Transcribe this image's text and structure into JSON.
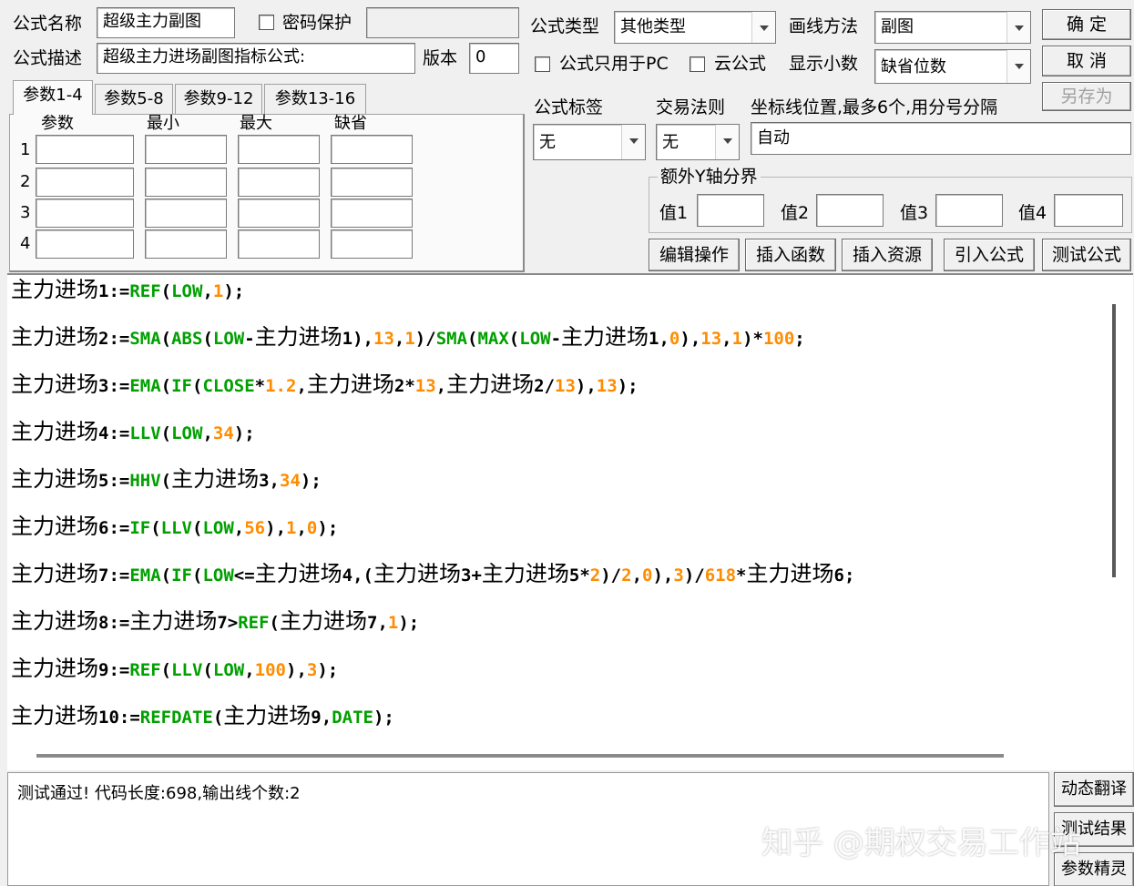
{
  "form": {
    "name_label": "公式名称",
    "name_value": "超级主力副图",
    "password_label": "密码保护",
    "password_value": "",
    "desc_label": "公式描述",
    "desc_value": "超级主力进场副图指标公式:",
    "version_label": "版本",
    "version_value": "0",
    "type_label": "公式类型",
    "type_value": "其他类型",
    "draw_label": "画线方法",
    "draw_value": "副图",
    "pc_only_label": "公式只用于PC",
    "cloud_label": "云公式",
    "decimals_label": "显示小数",
    "decimals_value": "缺省位数",
    "tag_label": "公式标签",
    "tag_value": "无",
    "rule_label": "交易法则",
    "rule_value": "无",
    "axis_label": "坐标线位置,最多6个,用分号分隔",
    "axis_value": "自动",
    "yaxis_group_label": "额外Y轴分界",
    "yaxis_values": [
      "值1",
      "值2",
      "值3",
      "值4"
    ]
  },
  "buttons": {
    "ok": "确 定",
    "cancel": "取 消",
    "save_as": "另存为",
    "edit_ops": "编辑操作",
    "insert_func": "插入函数",
    "insert_res": "插入资源",
    "import_formula": "引入公式",
    "test_formula": "测试公式",
    "dynamic_translate": "动态翻译",
    "test_result": "测试结果",
    "param_wizard": "参数精灵"
  },
  "tabs": [
    "参数1-4",
    "参数5-8",
    "参数9-12",
    "参数13-16"
  ],
  "params": {
    "headers": [
      "参数",
      "最小",
      "最大",
      "缺省"
    ],
    "rows": [
      "1",
      "2",
      "3",
      "4"
    ]
  },
  "code_lines": [
    [
      [
        "cn",
        "主力进场"
      ],
      [
        "p",
        "1:="
      ],
      [
        "k",
        "REF"
      ],
      [
        "p",
        "("
      ],
      [
        "k",
        "LOW"
      ],
      [
        "p",
        ","
      ],
      [
        "n",
        "1"
      ],
      [
        "p",
        ");"
      ]
    ],
    [
      [
        "cn",
        "主力进场"
      ],
      [
        "p",
        "2:="
      ],
      [
        "k",
        "SMA"
      ],
      [
        "p",
        "("
      ],
      [
        "k",
        "ABS"
      ],
      [
        "p",
        "("
      ],
      [
        "k",
        "LOW"
      ],
      [
        "p",
        "-"
      ],
      [
        "cn",
        "主力进场"
      ],
      [
        "p",
        "1),"
      ],
      [
        "n",
        "13"
      ],
      [
        "p",
        ","
      ],
      [
        "n",
        "1"
      ],
      [
        "p",
        ")/"
      ],
      [
        "k",
        "SMA"
      ],
      [
        "p",
        "("
      ],
      [
        "k",
        "MAX"
      ],
      [
        "p",
        "("
      ],
      [
        "k",
        "LOW"
      ],
      [
        "p",
        "-"
      ],
      [
        "cn",
        "主力进场"
      ],
      [
        "p",
        "1,"
      ],
      [
        "n",
        "0"
      ],
      [
        "p",
        "),"
      ],
      [
        "n",
        "13"
      ],
      [
        "p",
        ","
      ],
      [
        "n",
        "1"
      ],
      [
        "p",
        ")*"
      ],
      [
        "n",
        "100"
      ],
      [
        "p",
        ";"
      ]
    ],
    [
      [
        "cn",
        "主力进场"
      ],
      [
        "p",
        "3:="
      ],
      [
        "k",
        "EMA"
      ],
      [
        "p",
        "("
      ],
      [
        "k",
        "IF"
      ],
      [
        "p",
        "("
      ],
      [
        "k",
        "CLOSE"
      ],
      [
        "p",
        "*"
      ],
      [
        "n",
        "1.2"
      ],
      [
        "p",
        ","
      ],
      [
        "cn",
        "主力进场"
      ],
      [
        "p",
        "2*"
      ],
      [
        "n",
        "13"
      ],
      [
        "p",
        ","
      ],
      [
        "cn",
        "主力进场"
      ],
      [
        "p",
        "2/"
      ],
      [
        "n",
        "13"
      ],
      [
        "p",
        "),"
      ],
      [
        "n",
        "13"
      ],
      [
        "p",
        ");"
      ]
    ],
    [
      [
        "cn",
        "主力进场"
      ],
      [
        "p",
        "4:="
      ],
      [
        "k",
        "LLV"
      ],
      [
        "p",
        "("
      ],
      [
        "k",
        "LOW"
      ],
      [
        "p",
        ","
      ],
      [
        "n",
        "34"
      ],
      [
        "p",
        ");"
      ]
    ],
    [
      [
        "cn",
        "主力进场"
      ],
      [
        "p",
        "5:="
      ],
      [
        "k",
        "HHV"
      ],
      [
        "p",
        "("
      ],
      [
        "cn",
        "主力进场"
      ],
      [
        "p",
        "3,"
      ],
      [
        "n",
        "34"
      ],
      [
        "p",
        ");"
      ]
    ],
    [
      [
        "cn",
        "主力进场"
      ],
      [
        "p",
        "6:="
      ],
      [
        "k",
        "IF"
      ],
      [
        "p",
        "("
      ],
      [
        "k",
        "LLV"
      ],
      [
        "p",
        "("
      ],
      [
        "k",
        "LOW"
      ],
      [
        "p",
        ","
      ],
      [
        "n",
        "56"
      ],
      [
        "p",
        "),"
      ],
      [
        "n",
        "1"
      ],
      [
        "p",
        ","
      ],
      [
        "n",
        "0"
      ],
      [
        "p",
        ");"
      ]
    ],
    [
      [
        "cn",
        "主力进场"
      ],
      [
        "p",
        "7:="
      ],
      [
        "k",
        "EMA"
      ],
      [
        "p",
        "("
      ],
      [
        "k",
        "IF"
      ],
      [
        "p",
        "("
      ],
      [
        "k",
        "LOW"
      ],
      [
        "p",
        "<="
      ],
      [
        "cn",
        "主力进场"
      ],
      [
        "p",
        "4,("
      ],
      [
        "cn",
        "主力进场"
      ],
      [
        "p",
        "3+"
      ],
      [
        "cn",
        "主力进场"
      ],
      [
        "p",
        "5*"
      ],
      [
        "n",
        "2"
      ],
      [
        "p",
        ")/"
      ],
      [
        "n",
        "2"
      ],
      [
        "p",
        ","
      ],
      [
        "n",
        "0"
      ],
      [
        "p",
        "),"
      ],
      [
        "n",
        "3"
      ],
      [
        "p",
        ")/"
      ],
      [
        "n",
        "618"
      ],
      [
        "p",
        "*"
      ],
      [
        "cn",
        "主力进场"
      ],
      [
        "p",
        "6;"
      ]
    ],
    [
      [
        "cn",
        "主力进场"
      ],
      [
        "p",
        "8:="
      ],
      [
        "cn",
        "主力进场"
      ],
      [
        "p",
        "7>"
      ],
      [
        "k",
        "REF"
      ],
      [
        "p",
        "("
      ],
      [
        "cn",
        "主力进场"
      ],
      [
        "p",
        "7,"
      ],
      [
        "n",
        "1"
      ],
      [
        "p",
        ");"
      ]
    ],
    [
      [
        "cn",
        "主力进场"
      ],
      [
        "p",
        "9:="
      ],
      [
        "k",
        "REF"
      ],
      [
        "p",
        "("
      ],
      [
        "k",
        "LLV"
      ],
      [
        "p",
        "("
      ],
      [
        "k",
        "LOW"
      ],
      [
        "p",
        ","
      ],
      [
        "n",
        "100"
      ],
      [
        "p",
        "),"
      ],
      [
        "n",
        "3"
      ],
      [
        "p",
        ");"
      ]
    ],
    [
      [
        "cn",
        "主力进场"
      ],
      [
        "p",
        "10:="
      ],
      [
        "k",
        "REFDATE"
      ],
      [
        "p",
        "("
      ],
      [
        "cn",
        "主力进场"
      ],
      [
        "p",
        "9,"
      ],
      [
        "k",
        "DATE"
      ],
      [
        "p",
        ");"
      ]
    ]
  ],
  "output": {
    "message": "测试通过! 代码长度:698,输出线个数:2"
  },
  "watermark": "知乎 @期权交易工作站",
  "colors": {
    "keyword": "#00a000",
    "number": "#ff8c00",
    "background": "#f0f0f0"
  }
}
